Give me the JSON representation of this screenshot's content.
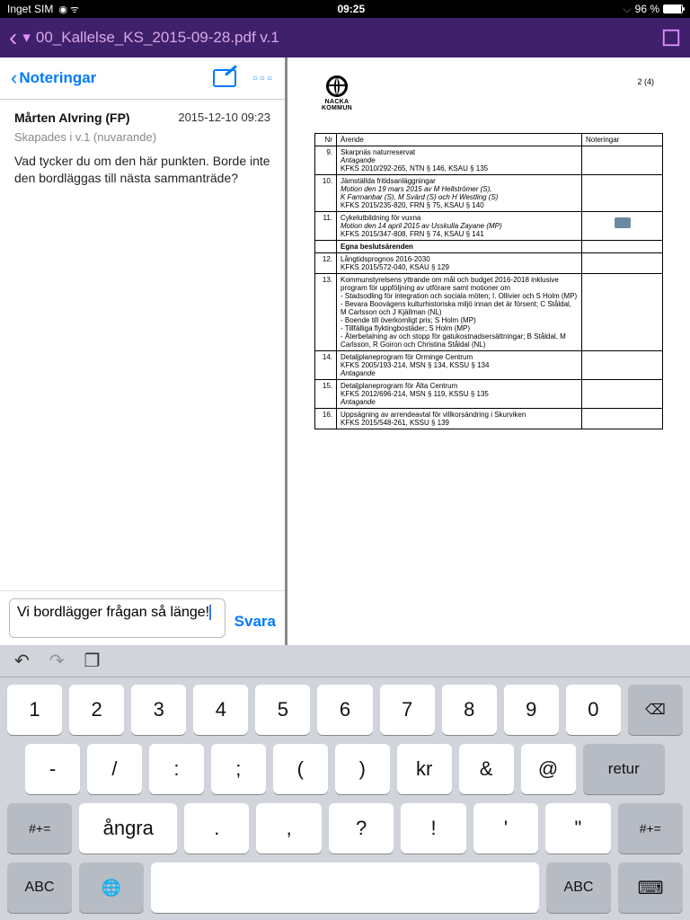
{
  "status": {
    "carrier": "Inget SIM",
    "time": "09:25",
    "battery": "96 %"
  },
  "nav": {
    "doc_title": "00_Kallelse_KS_2015-09-28.pdf  v.1"
  },
  "notes_header": {
    "title": "Noteringar"
  },
  "note": {
    "author": "Mårten Alvring (FP)",
    "timestamp": "2015-12-10 09:23",
    "created": "Skapades i v.1 (nuvarande)",
    "body": "Vad tycker du om den här punkten. Borde inte den bordläggas till nästa sammanträde?"
  },
  "reply": {
    "text": "Vi bordlägger frågan så länge!",
    "button": "Svara"
  },
  "doc": {
    "logo_text": "NACKA KOMMUN",
    "page_num": "2 (4)",
    "headers": {
      "nr": "Nr",
      "arende": "Ärende",
      "noteringar": "Noteringar"
    },
    "rows": [
      {
        "nr": "9.",
        "lines": [
          "Skarpnäs naturreservat",
          "<i>Antagande</i>",
          "KFKS 2010/292-265, NTN § 146, KSAU § 135"
        ]
      },
      {
        "nr": "10.",
        "lines": [
          "Jämställda fritidsanläggningar",
          "<i>Motion den 19 mars 2015 av M Hellströmer (S),</i>",
          "<i>K Farmanbar (S), M Svärd (S) och H Westling (S)</i>",
          "KFKS 2015/235-820, FRN § 75, KSAU § 140"
        ]
      },
      {
        "nr": "11.",
        "lines": [
          "Cykelutbildning för vuxna",
          "<i>Motion den 14 april 2015 av Usskulla Zayane (MP)</i>",
          "KFKS 2015/347-808, FRN § 74, KSAU § 141"
        ],
        "hasNote": true
      },
      {
        "nr": "",
        "lines": [
          "<b>Egna beslutsärenden</b>"
        ]
      },
      {
        "nr": "12.",
        "lines": [
          "Långtidsprognos 2016-2030",
          "KFKS 2015/572-040, KSAU § 129"
        ]
      },
      {
        "nr": "13.",
        "lines": [
          "Kommunstyrelsens yttrande om mål och budget 2016-2018 inklusive program för uppföljning av utförare samt motioner om",
          "-  Stadsodling för integration och sociala möten; I. Ollivier och S Holm (MP)",
          "-  Bevara Boovägens kulturhistoriska miljö innan det är försent; C Ståldal, M Carlsson och J Kjällman (NL)",
          "-  Boende till överkomligt pris; S Holm (MP)",
          "-  Tillfälliga flyktingbostäder; S Holm (MP)",
          "-  Återbetalning av och stopp för gatukostnadsersättningar; B Ståldal, M Carlsson, R Goiron och Christina Ståldal (NL)"
        ]
      },
      {
        "nr": "14.",
        "lines": [
          "Detaljplaneprogram för Orminge Centrum",
          "KFKS 2005/193-214, MSN § 134, KSSU § 134",
          "<i>Antagande</i>"
        ]
      },
      {
        "nr": "15.",
        "lines": [
          "Detaljplaneprogram för Älta Centrum",
          "KFKS 2012/696-214, MSN § 119, KSSU § 135",
          "<i>Antagande</i>"
        ]
      },
      {
        "nr": "16.",
        "lines": [
          "Uppsägning av arrendeavtal för villkorsändring i Skurviken",
          "KFKS 2015/548-261, KSSU § 139"
        ]
      }
    ]
  },
  "keyboard": {
    "row1": [
      "1",
      "2",
      "3",
      "4",
      "5",
      "6",
      "7",
      "8",
      "9",
      "0"
    ],
    "row2": [
      "-",
      "/",
      ":",
      ";",
      "(",
      ")",
      "kr",
      "&",
      "@"
    ],
    "retur": "retur",
    "row3_mod": "#+=",
    "row3": [
      ".",
      ",",
      "?",
      "!",
      "'",
      "\""
    ],
    "angra": "ångra",
    "abc": "ABC"
  }
}
